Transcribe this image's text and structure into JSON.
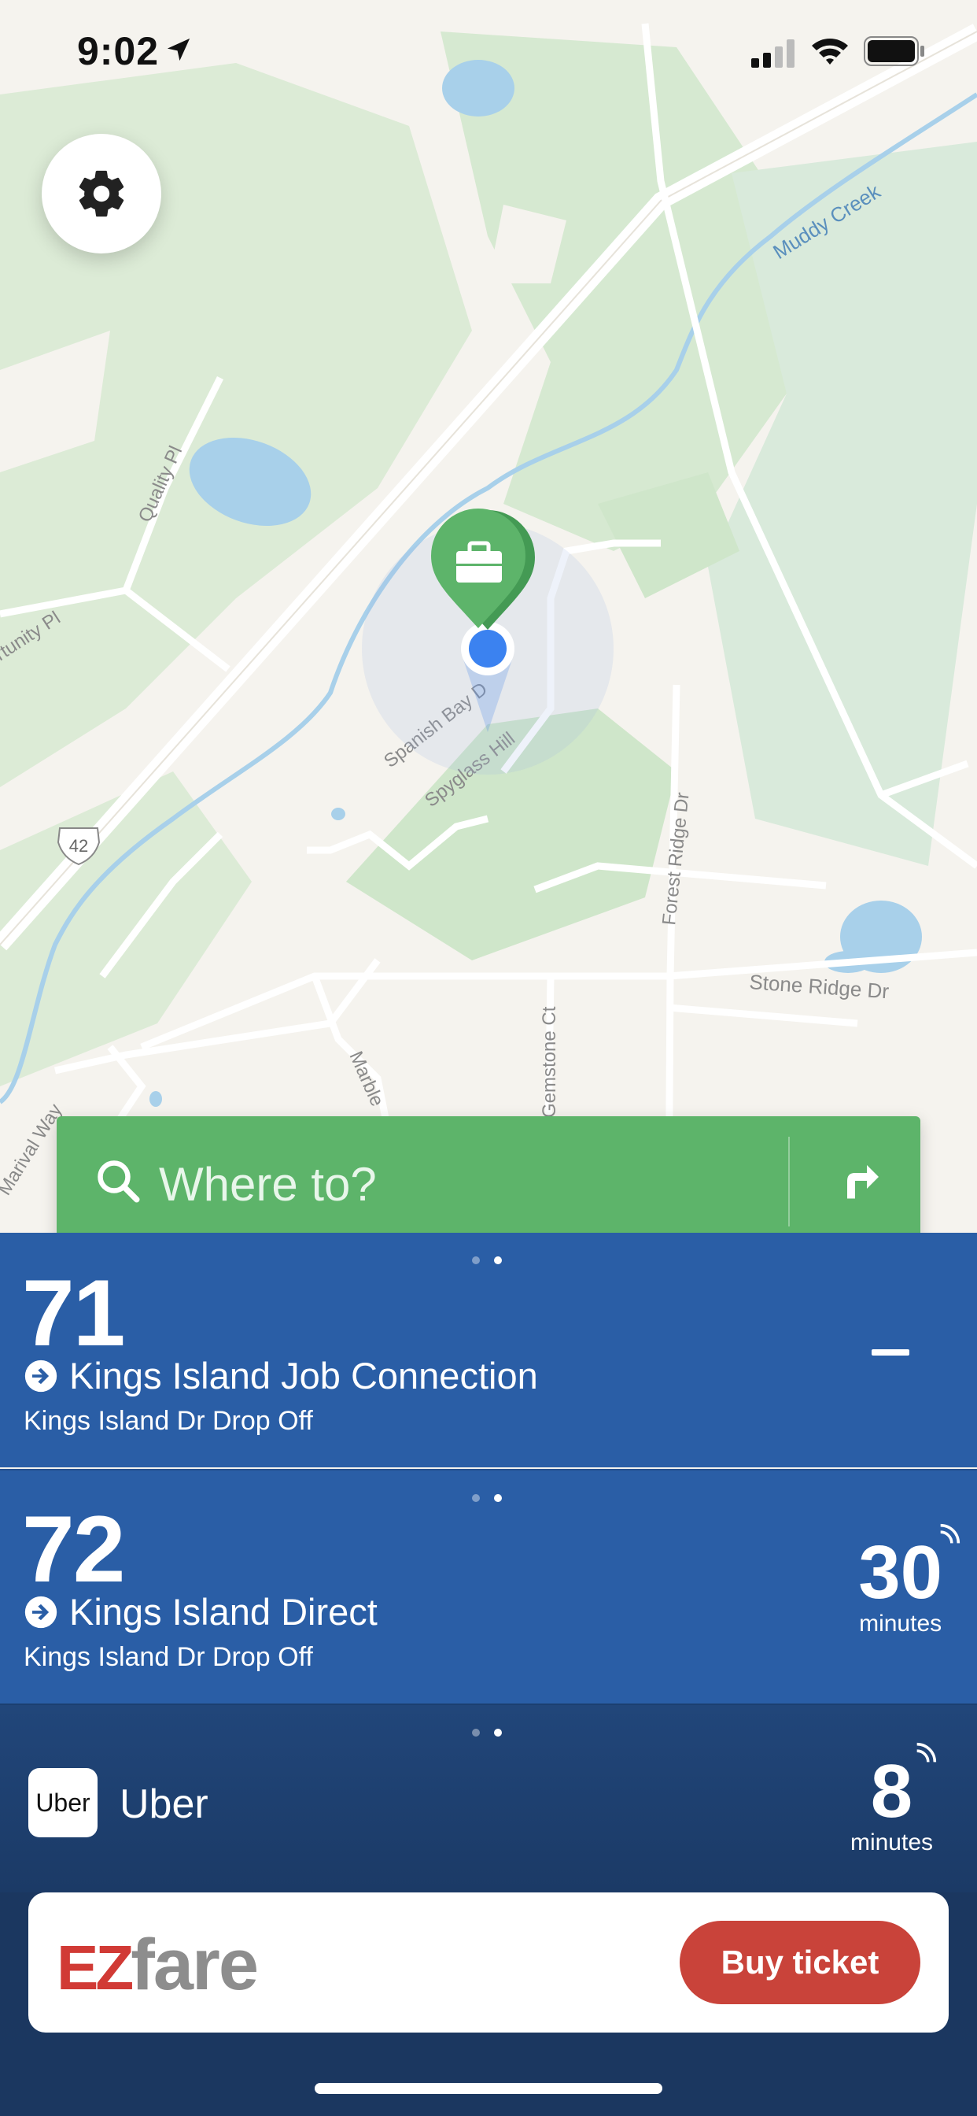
{
  "status_bar": {
    "time": "9:02"
  },
  "map": {
    "labels": {
      "muddy_creek": "Muddy Creek",
      "quality_pl": "Quality Pl",
      "opportunity_pl": "rtunity Pl",
      "spanish_bay": "Spanish Bay D",
      "spyglass_hill": "Spyglass Hill",
      "forest_ridge": "Forest Ridge Dr",
      "stone_ridge": "Stone Ridge Dr",
      "gemstone": "Gemstone Ct",
      "marble": "Marble",
      "marival": "Marival Way",
      "route_shield": "42"
    }
  },
  "search": {
    "placeholder": "Where to?"
  },
  "routes": [
    {
      "number": "71",
      "name": "Kings Island Job Connection",
      "stop": "Kings Island Dr Drop Off",
      "eta": "–"
    },
    {
      "number": "72",
      "name": "Kings Island Direct",
      "stop": "Kings Island Dr Drop Off",
      "eta": "30",
      "eta_unit": "minutes"
    }
  ],
  "uber": {
    "logo_text": "Uber",
    "name": "Uber",
    "eta": "8",
    "eta_unit": "minutes"
  },
  "ezfare": {
    "logo_ez": "EZ",
    "logo_fare": "fare",
    "buy_label": "Buy ticket"
  },
  "colors": {
    "search_green": "#5db46a",
    "route_blue": "#2a5ea6",
    "uber_dark": "#1f4275",
    "buy_red": "#c9433a"
  },
  "icons": [
    "location-arrow-icon",
    "cellular-signal-icon",
    "wifi-icon",
    "battery-icon",
    "gear-icon",
    "search-icon",
    "turn-right-icon",
    "briefcase-pin-icon",
    "route-arrow-icon",
    "realtime-signal-icon"
  ]
}
